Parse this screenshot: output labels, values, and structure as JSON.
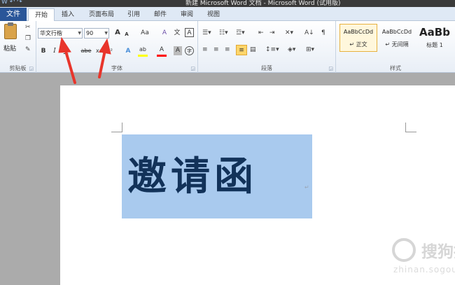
{
  "titlebar": {
    "title": "新建 Microsoft Word 文档 - Microsoft Word (试用版)",
    "quick_access": "W ↶ ↷"
  },
  "tabs": {
    "file": "文件",
    "items": [
      "开始",
      "插入",
      "页面布局",
      "引用",
      "邮件",
      "审阅",
      "视图"
    ],
    "active": "开始"
  },
  "clipboard": {
    "paste_label": "粘贴",
    "group_label": "剪贴板",
    "cut_icon": "scissors-icon",
    "copy_icon": "copy-icon",
    "format_painter_icon": "brush-icon"
  },
  "font": {
    "font_name": "华文行楷",
    "font_size": "90",
    "grow": "A",
    "shrink": "A",
    "change_case": "Aa",
    "clear_format": "A",
    "bold": "B",
    "italic": "I",
    "underline": "U",
    "strike": "abe",
    "subscript": "x₂",
    "superscript": "x²",
    "text_effect": "A",
    "highlight": "ab",
    "font_color": "A",
    "char_shading": "A",
    "enclose": "字",
    "phonetic": "文",
    "border": "A",
    "group_label": "字体",
    "highlight_color": "#ffff00",
    "font_color_value": "#ff0000"
  },
  "paragraph": {
    "group_label": "段落",
    "row1": [
      "bullets-icon",
      "numbering-icon",
      "multilevel-icon",
      "decrease-indent-icon",
      "increase-indent-icon",
      "chinese-layout-icon",
      "sort-icon",
      "show-marks-icon"
    ],
    "row2": [
      "align-left-icon",
      "center-icon",
      "align-right-icon",
      "justify-icon",
      "distributed-icon",
      "line-spacing-icon",
      "shading-icon",
      "borders-icon"
    ]
  },
  "styles": {
    "group_label": "样式",
    "items": [
      {
        "preview": "AaBbCcDd",
        "name": "↵ 正文"
      },
      {
        "preview": "AaBbCcDd",
        "name": "↵ 无间隔"
      },
      {
        "preview": "AaBb",
        "name": "标题 1"
      }
    ]
  },
  "document": {
    "content": "邀请函",
    "paragraph_mark": "↵"
  },
  "watermark": {
    "text": "搜狗指南",
    "url": "zhinan.sogou.com"
  },
  "colors": {
    "file_tab": "#2a5699",
    "selection": "#a9caee",
    "text": "#123259",
    "annotation_arrow": "#e8352b"
  }
}
